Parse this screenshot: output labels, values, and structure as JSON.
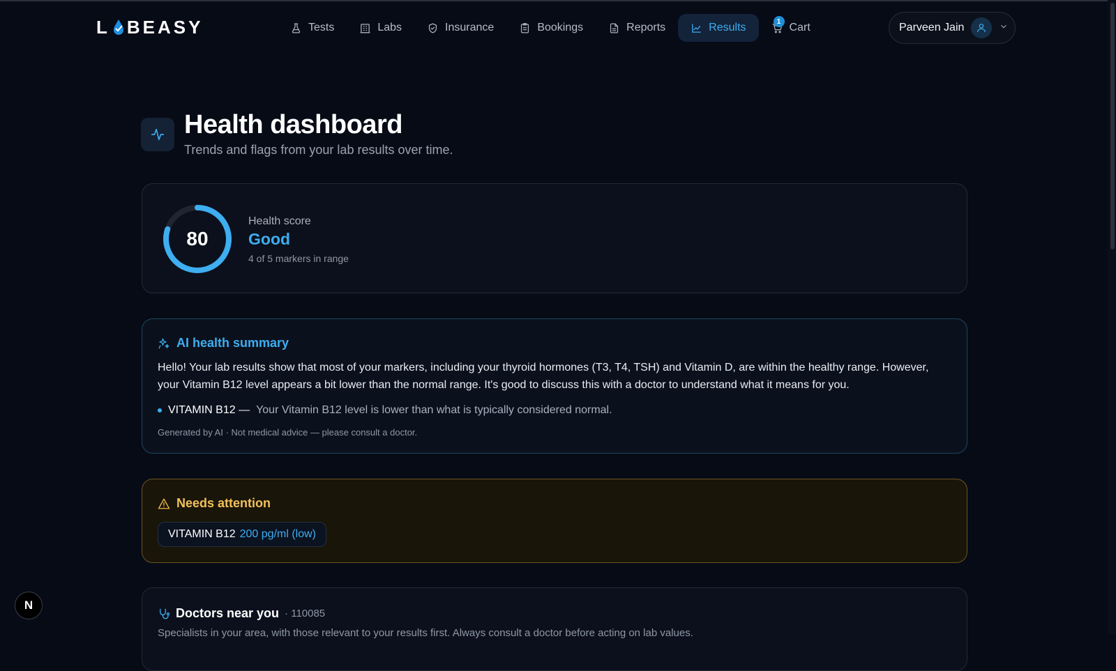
{
  "nav": {
    "logo": "LABEASY",
    "items": [
      {
        "label": "Tests",
        "icon": "flask-icon"
      },
      {
        "label": "Labs",
        "icon": "building-icon"
      },
      {
        "label": "Insurance",
        "icon": "shield-icon"
      },
      {
        "label": "Bookings",
        "icon": "clipboard-icon"
      },
      {
        "label": "Reports",
        "icon": "document-icon"
      },
      {
        "label": "Results",
        "icon": "chart-line-icon",
        "active": true
      }
    ],
    "cart": {
      "label": "Cart",
      "count": "1",
      "icon": "cart-icon"
    },
    "user": {
      "name": "Parveen Jain",
      "icon": "user-icon"
    }
  },
  "header": {
    "title": "Health dashboard",
    "subtitle": "Trends and flags from your lab results over time.",
    "icon": "activity-icon"
  },
  "score": {
    "value": "80",
    "percent": 80,
    "label": "Health score",
    "rating": "Good",
    "detail": "4 of 5 markers in range"
  },
  "ai_summary": {
    "title": "AI health summary",
    "icon": "sparkles-icon",
    "text": "Hello! Your lab results show that most of your markers, including your thyroid hormones (T3, T4, TSH) and Vitamin D, are within the healthy range. However, your Vitamin B12 level appears a bit lower than the normal range. It's good to discuss this with a doctor to understand what it means for you.",
    "bullet_marker": "VITAMIN B12 —",
    "bullet_text": "Your Vitamin B12 level is lower than what is typically considered normal.",
    "footer": "Generated by AI · Not medical advice — please consult a doctor."
  },
  "attention": {
    "title": "Needs attention",
    "icon": "warning-icon",
    "chip_name": "VITAMIN B12",
    "chip_value": "200 pg/ml (low)"
  },
  "doctors": {
    "title": "Doctors near you",
    "pincode": "· 110085",
    "icon": "stethoscope-icon",
    "subtitle": "Specialists in your area, with those relevant to your results first. Always consult a doctor before acting on lab values."
  },
  "colors": {
    "accent": "#3eaef0",
    "warning": "#f2c15a",
    "background": "#070b16"
  },
  "floating_button": "N"
}
